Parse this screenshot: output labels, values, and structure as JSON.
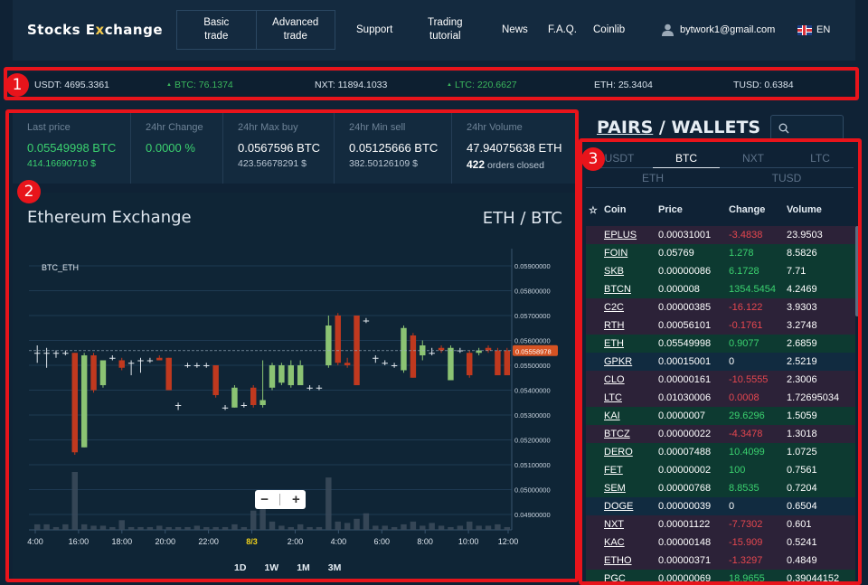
{
  "nav": {
    "logo_pre": "Stocks E",
    "logo_x": "x",
    "logo_post": "change",
    "basic_trade": "Basic\ntrade",
    "advanced_trade": "Advanced\ntrade",
    "support": "Support",
    "trading_tutorial": "Trading\ntutorial",
    "news": "News",
    "faq": "F.A.Q.",
    "coinlib": "Coinlib",
    "user_email": "bytwork1@gmail.com",
    "language": "EN"
  },
  "ticker": [
    {
      "text": "USDT: 4695.3361",
      "trend": "none"
    },
    {
      "text": "BTC: 76.1374",
      "trend": "up"
    },
    {
      "text": "NXT: 11894.1033",
      "trend": "none"
    },
    {
      "text": "LTC: 220.6627",
      "trend": "up"
    },
    {
      "text": "ETH: 25.3404",
      "trend": "none"
    },
    {
      "text": "TUSD: 0.6384",
      "trend": "none"
    }
  ],
  "badges": [
    "1",
    "2",
    "3"
  ],
  "stats": {
    "last_price": {
      "label": "Last price",
      "value": "0.05549998 BTC",
      "sub": "414.16690710 $"
    },
    "change": {
      "label": "24hr Change",
      "value": "0.0000 %"
    },
    "max_buy": {
      "label": "24hr Max buy",
      "value": "0.0567596 BTC",
      "sub": "423.56678291 $"
    },
    "min_sell": {
      "label": "24hr Min sell",
      "value": "0.05125666 BTC",
      "sub": "382.50126109 $"
    },
    "volume": {
      "label": "24hr Volume",
      "value": "47.94075638 ETH",
      "orders_count": "422",
      "orders_label": " orders closed"
    }
  },
  "exchange": {
    "title": "Ethereum Exchange",
    "pair": "ETH / BTC",
    "zoom_out": "−",
    "zoom_in": "+",
    "ranges": [
      "1D",
      "1W",
      "1M",
      "3M"
    ]
  },
  "chart_data": {
    "type": "candlestick",
    "legend": "BTC_ETH",
    "x_labels": [
      "4:00",
      "16:00",
      "18:00",
      "20:00",
      "22:00",
      "8/3",
      "2:00",
      "4:00",
      "6:00",
      "8:00",
      "10:00",
      "12:00"
    ],
    "highlight_x_label": "8/3",
    "y_ticks": [
      "0.05900000",
      "0.05800000",
      "0.05700000",
      "0.05600000",
      "0.05500000",
      "0.05400000",
      "0.05300000",
      "0.05200000",
      "0.05100000",
      "0.05000000",
      "0.04900000"
    ],
    "ylim": [
      0.0487,
      0.0595
    ],
    "last_price_label": "0.05558978",
    "last_price_value": 0.05558978,
    "candles": [
      {
        "o": 0.0555,
        "h": 0.0558,
        "l": 0.0551,
        "c": 0.0555
      },
      {
        "o": 0.0555,
        "h": 0.0557,
        "l": 0.0549,
        "c": 0.0555
      },
      {
        "o": 0.0555,
        "h": 0.0556,
        "l": 0.0553,
        "c": 0.0555
      },
      {
        "o": 0.0555,
        "h": 0.0556,
        "l": 0.0554,
        "c": 0.0555
      },
      {
        "o": 0.0555,
        "h": 0.0555,
        "l": 0.0514,
        "c": 0.0515
      },
      {
        "o": 0.0517,
        "h": 0.0555,
        "l": 0.0517,
        "c": 0.0554
      },
      {
        "o": 0.0554,
        "h": 0.0555,
        "l": 0.0539,
        "c": 0.054
      },
      {
        "o": 0.0542,
        "h": 0.0552,
        "l": 0.0541,
        "c": 0.0552
      },
      {
        "o": 0.0553,
        "h": 0.0554,
        "l": 0.0552,
        "c": 0.0553
      },
      {
        "o": 0.0552,
        "h": 0.0553,
        "l": 0.0548,
        "c": 0.0549
      },
      {
        "o": 0.0551,
        "h": 0.0552,
        "l": 0.0546,
        "c": 0.0551
      },
      {
        "o": 0.0552,
        "h": 0.0553,
        "l": 0.0547,
        "c": 0.0552
      },
      {
        "o": 0.0552,
        "h": 0.0553,
        "l": 0.0551,
        "c": 0.0552
      },
      {
        "o": 0.0553,
        "h": 0.0554,
        "l": 0.0552,
        "c": 0.0552
      },
      {
        "o": 0.0553,
        "h": 0.0553,
        "l": 0.054,
        "c": 0.054
      },
      {
        "o": 0.0534,
        "h": 0.0535,
        "l": 0.0532,
        "c": 0.0534
      },
      {
        "o": 0.055,
        "h": 0.0551,
        "l": 0.0549,
        "c": 0.055
      },
      {
        "o": 0.055,
        "h": 0.0551,
        "l": 0.0549,
        "c": 0.055
      },
      {
        "o": 0.055,
        "h": 0.0551,
        "l": 0.0549,
        "c": 0.055
      },
      {
        "o": 0.055,
        "h": 0.055,
        "l": 0.0537,
        "c": 0.0538
      },
      {
        "o": 0.0533,
        "h": 0.0534,
        "l": 0.0532,
        "c": 0.0533
      },
      {
        "o": 0.0533,
        "h": 0.0542,
        "l": 0.0533,
        "c": 0.0541
      },
      {
        "o": 0.0534,
        "h": 0.0535,
        "l": 0.0533,
        "c": 0.0534
      },
      {
        "o": 0.0541,
        "h": 0.0542,
        "l": 0.0533,
        "c": 0.0534
      },
      {
        "o": 0.0534,
        "h": 0.0552,
        "l": 0.0533,
        "c": 0.0536
      },
      {
        "o": 0.0541,
        "h": 0.0551,
        "l": 0.054,
        "c": 0.055
      },
      {
        "o": 0.0543,
        "h": 0.0551,
        "l": 0.0542,
        "c": 0.055
      },
      {
        "o": 0.0542,
        "h": 0.0552,
        "l": 0.0541,
        "c": 0.055
      },
      {
        "o": 0.0542,
        "h": 0.0552,
        "l": 0.0542,
        "c": 0.055
      },
      {
        "o": 0.0541,
        "h": 0.0542,
        "l": 0.054,
        "c": 0.0541
      },
      {
        "o": 0.0541,
        "h": 0.0542,
        "l": 0.054,
        "c": 0.0541
      },
      {
        "o": 0.055,
        "h": 0.057,
        "l": 0.0549,
        "c": 0.0566
      },
      {
        "o": 0.057,
        "h": 0.0571,
        "l": 0.055,
        "c": 0.0551
      },
      {
        "o": 0.0551,
        "h": 0.0553,
        "l": 0.0549,
        "c": 0.055
      },
      {
        "o": 0.057,
        "h": 0.057,
        "l": 0.0542,
        "c": 0.0542
      },
      {
        "o": 0.0568,
        "h": 0.0569,
        "l": 0.0567,
        "c": 0.0568
      },
      {
        "o": 0.0553,
        "h": 0.0554,
        "l": 0.0551,
        "c": 0.0553
      },
      {
        "o": 0.0551,
        "h": 0.0552,
        "l": 0.055,
        "c": 0.0551
      },
      {
        "o": 0.055,
        "h": 0.0551,
        "l": 0.0549,
        "c": 0.055
      },
      {
        "o": 0.0548,
        "h": 0.0566,
        "l": 0.0547,
        "c": 0.0565
      },
      {
        "o": 0.0562,
        "h": 0.0563,
        "l": 0.0545,
        "c": 0.0545
      },
      {
        "o": 0.0554,
        "h": 0.056,
        "l": 0.0552,
        "c": 0.0558
      },
      {
        "o": 0.0555,
        "h": 0.0557,
        "l": 0.0554,
        "c": 0.0555
      },
      {
        "o": 0.0557,
        "h": 0.0558,
        "l": 0.0555,
        "c": 0.0556
      },
      {
        "o": 0.0544,
        "h": 0.0558,
        "l": 0.0544,
        "c": 0.0557
      },
      {
        "o": 0.0556,
        "h": 0.0557,
        "l": 0.0555,
        "c": 0.0556
      },
      {
        "o": 0.0555,
        "h": 0.0556,
        "l": 0.0545,
        "c": 0.0546
      },
      {
        "o": 0.0555,
        "h": 0.0557,
        "l": 0.0554,
        "c": 0.0556
      },
      {
        "o": 0.0557,
        "h": 0.0558,
        "l": 0.0555,
        "c": 0.0556
      },
      {
        "o": 0.0556,
        "h": 0.0557,
        "l": 0.0546,
        "c": 0.0546
      },
      {
        "o": 0.0556,
        "h": 0.0557,
        "l": 0.0546,
        "c": 0.0546
      }
    ],
    "volumes": [
      4,
      4,
      2,
      4,
      42,
      4,
      3,
      3,
      2,
      7,
      2,
      2,
      2,
      3,
      2,
      2,
      2,
      3,
      2,
      2,
      2,
      4,
      2,
      14,
      18,
      6,
      3,
      2,
      4,
      2,
      2,
      38,
      6,
      5,
      8,
      12,
      3,
      3,
      2,
      4,
      6,
      3,
      5,
      3,
      2,
      3,
      6,
      3,
      3,
      4,
      2,
      12
    ],
    "colors": {
      "up": "#8bc373",
      "down": "#c0391f",
      "neutral": "#e0e6ec",
      "price_tag": "#d65323",
      "highlight_label": "#f2d31b"
    }
  },
  "pairs": {
    "title_a": "PAIRS",
    "title_sep": " / ",
    "title_b": "WALLETS",
    "tabs_row1": [
      "USDT",
      "BTC",
      "NXT",
      "LTC"
    ],
    "active_tab": "BTC",
    "tabs_row2": [
      "ETH",
      "TUSD"
    ],
    "columns": {
      "coin": "Coin",
      "price": "Price",
      "change": "Change",
      "volume": "Volume"
    },
    "rows": [
      {
        "coin": "EPLUS",
        "price": "0.00031001",
        "change": "-3.4838",
        "volume": "23.9503",
        "dir": "neg"
      },
      {
        "coin": "FOIN",
        "price": "0.05769",
        "change": "1.278",
        "volume": "8.5826",
        "dir": "pos"
      },
      {
        "coin": "SKB",
        "price": "0.00000086",
        "change": "6.1728",
        "volume": "7.71",
        "dir": "pos"
      },
      {
        "coin": "BTCN",
        "price": "0.000008",
        "change": "1354.5454",
        "volume": "4.2469",
        "dir": "pos"
      },
      {
        "coin": "C2C",
        "price": "0.00000385",
        "change": "-16.122",
        "volume": "3.9303",
        "dir": "neg"
      },
      {
        "coin": "RTH",
        "price": "0.00056101",
        "change": "-0.1761",
        "volume": "3.2748",
        "dir": "neg"
      },
      {
        "coin": "ETH",
        "price": "0.05549998",
        "change": "0.9077",
        "volume": "2.6859",
        "dir": "pos"
      },
      {
        "coin": "GPKR",
        "price": "0.00015001",
        "change": "0",
        "volume": "2.5219",
        "dir": "zero"
      },
      {
        "coin": "CLO",
        "price": "0.00000161",
        "change": "-10.5555",
        "volume": "2.3006",
        "dir": "neg"
      },
      {
        "coin": "LTC",
        "price": "0.01030006",
        "change": "0.0008",
        "volume": "1.72695034",
        "dir": "neg"
      },
      {
        "coin": "KAI",
        "price": "0.0000007",
        "change": "29.6296",
        "volume": "1.5059",
        "dir": "pos"
      },
      {
        "coin": "BTCZ",
        "price": "0.00000022",
        "change": "-4.3478",
        "volume": "1.3018",
        "dir": "neg"
      },
      {
        "coin": "DERO",
        "price": "0.00007488",
        "change": "10.4099",
        "volume": "1.0725",
        "dir": "pos"
      },
      {
        "coin": "FET",
        "price": "0.00000002",
        "change": "100",
        "volume": "0.7561",
        "dir": "pos"
      },
      {
        "coin": "SEM",
        "price": "0.00000768",
        "change": "8.8535",
        "volume": "0.7204",
        "dir": "pos"
      },
      {
        "coin": "DOGE",
        "price": "0.00000039",
        "change": "0",
        "volume": "0.6504",
        "dir": "zero"
      },
      {
        "coin": "NXT",
        "price": "0.00001122",
        "change": "-7.7302",
        "volume": "0.601",
        "dir": "neg"
      },
      {
        "coin": "KAC",
        "price": "0.00000148",
        "change": "-15.909",
        "volume": "0.5241",
        "dir": "neg"
      },
      {
        "coin": "ETHO",
        "price": "0.00000371",
        "change": "-1.3297",
        "volume": "0.4849",
        "dir": "neg"
      },
      {
        "coin": "PGC",
        "price": "0.00000069",
        "change": "18.9655",
        "volume": "0.39044152",
        "dir": "pos"
      }
    ]
  }
}
